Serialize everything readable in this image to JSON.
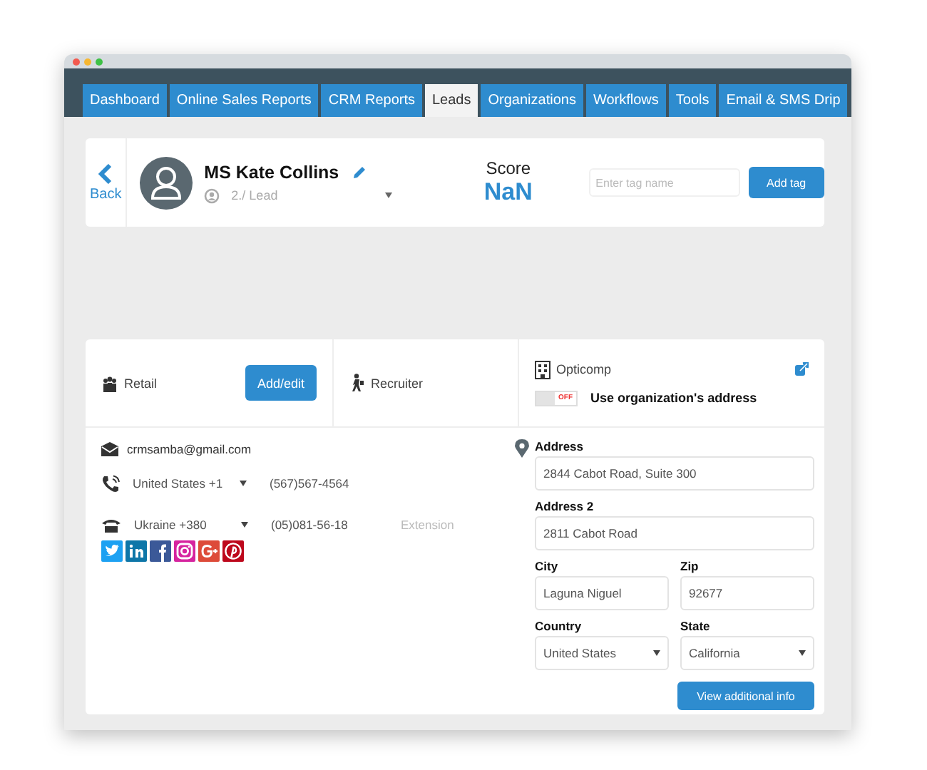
{
  "tabs": [
    {
      "label": "Dashboard",
      "selected": false
    },
    {
      "label": "Online Sales Reports",
      "selected": false
    },
    {
      "label": "CRM Reports",
      "selected": false
    },
    {
      "label": "Leads",
      "selected": true
    },
    {
      "label": "Organizations",
      "selected": false
    },
    {
      "label": "Workflows",
      "selected": false
    },
    {
      "label": "Tools",
      "selected": false
    },
    {
      "label": "Email & SMS Drip",
      "selected": false
    }
  ],
  "header": {
    "back": "Back",
    "name": "MS Kate Collins",
    "stage": "2./ Lead",
    "score_label": "Score",
    "score": "NaN",
    "tag_placeholder": "Enter tag name",
    "add_tag": "Add tag"
  },
  "profile": {
    "segment": "Retail",
    "add_edit": "Add/edit",
    "role": "Recruiter",
    "organization": "Opticomp",
    "toggle": {
      "on": false,
      "label": "OFF"
    },
    "toggle_caption": "Use organization's address"
  },
  "contact": {
    "email": "crmsamba@gmail.com",
    "phones": [
      {
        "kind": "mobile",
        "country": "United States +1",
        "number": "(567)567-4564"
      },
      {
        "kind": "landline",
        "country": "Ukraine +380",
        "number": "(05)081-56-18",
        "extension_placeholder": "Extension"
      }
    ]
  },
  "address": {
    "rows": [
      [
        {
          "label": "Address",
          "value": "2844 Cabot Road, Suite 300",
          "kind": "text"
        }
      ],
      [
        {
          "label": "Address 2",
          "value": "2811 Cabot Road",
          "kind": "text"
        }
      ],
      [
        {
          "label": "City",
          "value": "Laguna Niguel",
          "kind": "text"
        },
        {
          "label": "Zip",
          "value": "92677",
          "kind": "text"
        }
      ],
      [
        {
          "label": "Country",
          "value": "United States",
          "kind": "select"
        },
        {
          "label": "State",
          "value": "California",
          "kind": "select"
        }
      ]
    ],
    "button": "View additional info"
  }
}
